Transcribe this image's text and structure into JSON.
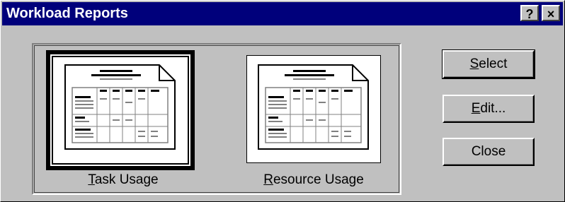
{
  "window": {
    "title": "Workload Reports",
    "help_symbol": "?",
    "close_symbol": "×"
  },
  "reports": [
    {
      "label_accel": "T",
      "label_rest": "ask Usage",
      "selected": true
    },
    {
      "label_accel": "R",
      "label_rest": "esource Usage",
      "selected": false
    }
  ],
  "buttons": {
    "select": {
      "accel": "S",
      "rest": "elect"
    },
    "edit": {
      "accel": "E",
      "rest": "dit..."
    },
    "close": {
      "label": "Close"
    }
  }
}
